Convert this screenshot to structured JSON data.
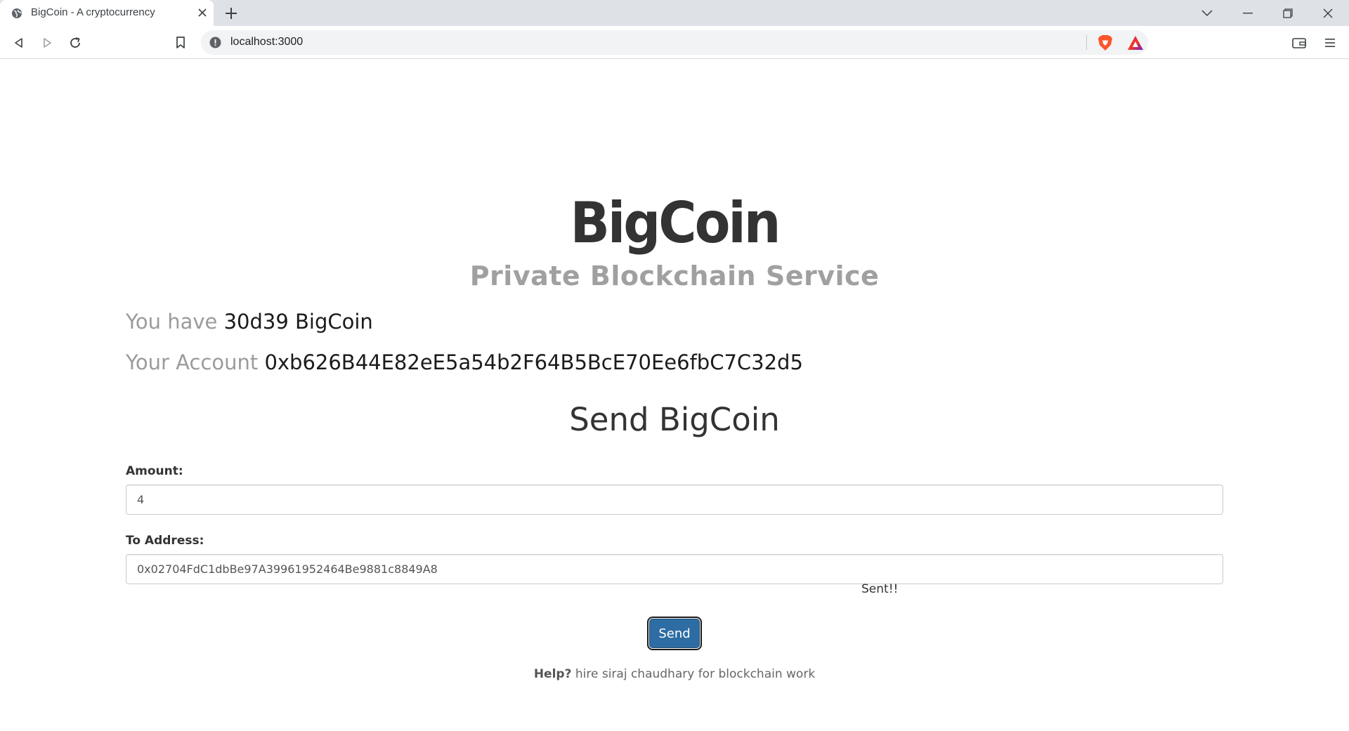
{
  "browser": {
    "tab": {
      "title": "BigCoin - A cryptocurrency",
      "favicon": "globe-icon"
    },
    "url": "localhost:3000",
    "icons": {
      "back": "back-icon",
      "forward": "forward-icon",
      "reload": "reload-icon",
      "bookmark": "bookmark-icon",
      "info": "info-icon",
      "brave_shield": "brave-lion-icon",
      "brave_rewards": "brave-rewards-icon",
      "wallet": "wallet-icon",
      "menu": "menu-icon"
    }
  },
  "header": {
    "title": "BigCoin",
    "subtitle": "Private Blockchain Service"
  },
  "balance": {
    "label": "You have",
    "value": "30d39 BigCoin"
  },
  "account": {
    "label": "Your Account",
    "value": "0xb626B44E82eE5a54b2F64B5BcE70Ee6fbC7C32d5"
  },
  "send_form": {
    "heading": "Send BigCoin",
    "amount_label": "Amount:",
    "amount_value": "4",
    "address_label": "To Address:",
    "address_value": "0x02704FdC1dbBe97A39961952464Be9881c8849A8",
    "status": "Sent!!",
    "button_label": "Send"
  },
  "footer": {
    "help_label": "Help?",
    "help_text": "hire siraj chaudhary for blockchain work"
  },
  "colors": {
    "title": "#333333",
    "subtitle": "#a0a0a0",
    "button": "#2e6da4",
    "brave_orange": "#fb542b"
  }
}
